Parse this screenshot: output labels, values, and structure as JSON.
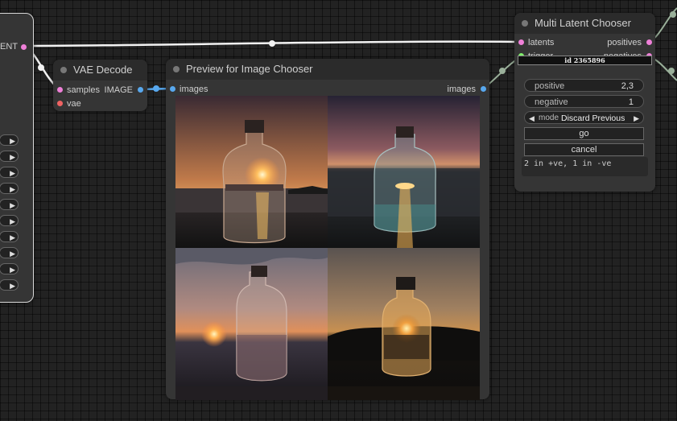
{
  "left_node": {
    "output_label": "ENT",
    "toggle_glyph": "▶"
  },
  "vae_decode": {
    "title": "VAE Decode",
    "inputs": [
      "samples",
      "vae"
    ],
    "output": "IMAGE"
  },
  "preview_chooser": {
    "title": "Preview for Image Chooser",
    "input": "images",
    "output": "images"
  },
  "multi_latent_chooser": {
    "title": "Multi Latent Chooser",
    "inputs": [
      "latents",
      "trigger"
    ],
    "outputs": [
      "positives",
      "negatives"
    ],
    "id_label": "id 2365896",
    "positive": {
      "label": "positive",
      "value": "2,3"
    },
    "negative": {
      "label": "negative",
      "value": "1"
    },
    "mode": {
      "label": "mode",
      "value": "Discard Previous",
      "left_arrow": "◀",
      "right_arrow": "▶"
    },
    "go_label": "go",
    "cancel_label": "cancel",
    "status": "2 in +ve, 1 in -ve"
  },
  "colors": {
    "latent": "#ef80d8",
    "vae": "#ef6363",
    "image": "#58a8ee",
    "trigger": "#7fef6a",
    "node_bg": "#353535"
  }
}
